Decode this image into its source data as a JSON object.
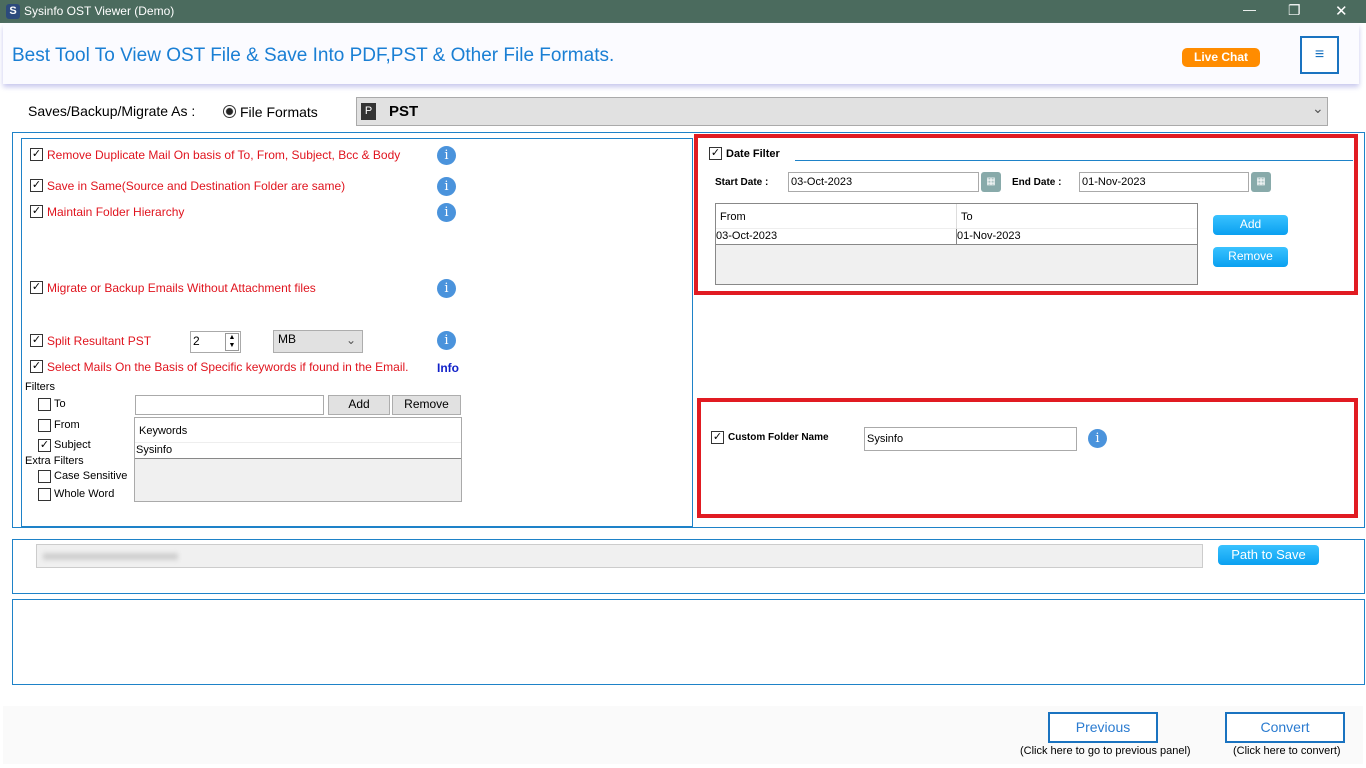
{
  "window": {
    "app_icon": "S",
    "title": "Sysinfo OST Viewer (Demo)",
    "minimize": "—",
    "restore": "❐",
    "close": "✕"
  },
  "header": {
    "tagline": "Best Tool To View OST File & Save Into PDF,PST & Other File Formats.",
    "live_chat": "Live Chat",
    "menu": "≡"
  },
  "save_as": {
    "label": "Saves/Backup/Migrate As :",
    "radio_label": "File Formats",
    "format_icon": "P",
    "format": "PST",
    "chevron": "⌄"
  },
  "options": [
    {
      "label": "Remove Duplicate Mail On basis of To, From, Subject, Bcc & Body",
      "checked": true
    },
    {
      "label": "Save in Same(Source and Destination Folder are same)",
      "checked": true
    },
    {
      "label": "Maintain Folder Hierarchy",
      "checked": true
    },
    {
      "label": "Migrate or Backup Emails Without Attachment files",
      "checked": true
    },
    {
      "label": "Split Resultant PST",
      "checked": true
    },
    {
      "label": "Select Mails On the Basis of Specific keywords if found in the Email.",
      "checked": true
    }
  ],
  "split": {
    "value": "2",
    "unit": "MB"
  },
  "info_link": "Info",
  "info_glyph": "i",
  "check": "✓",
  "filters": {
    "label": "Filters",
    "to": "To",
    "from": "From",
    "subject": "Subject",
    "extra_label": "Extra Filters",
    "case_sensitive": "Case Sensitive",
    "whole_word": "Whole Word",
    "keyword_value": "",
    "add": "Add",
    "remove": "Remove",
    "column": "Keywords",
    "rows": [
      "Sysinfo"
    ]
  },
  "date_filter": {
    "label": "Date Filter",
    "start_label": "Start Date :",
    "start": "03-Oct-2023",
    "end_label": "End Date :",
    "end": "01-Nov-2023",
    "columns": [
      "From",
      "To"
    ],
    "rows": [
      [
        "03-Oct-2023",
        "01-Nov-2023"
      ]
    ],
    "add": "Add",
    "remove": "Remove"
  },
  "custom_folder": {
    "label": "Custom Folder Name",
    "value": "Sysinfo"
  },
  "path": {
    "button": "Path to Save"
  },
  "footer": {
    "previous": "Previous",
    "previous_hint": "(Click here to go to previous panel)",
    "convert": "Convert",
    "convert_hint": "(Click here to convert)"
  }
}
